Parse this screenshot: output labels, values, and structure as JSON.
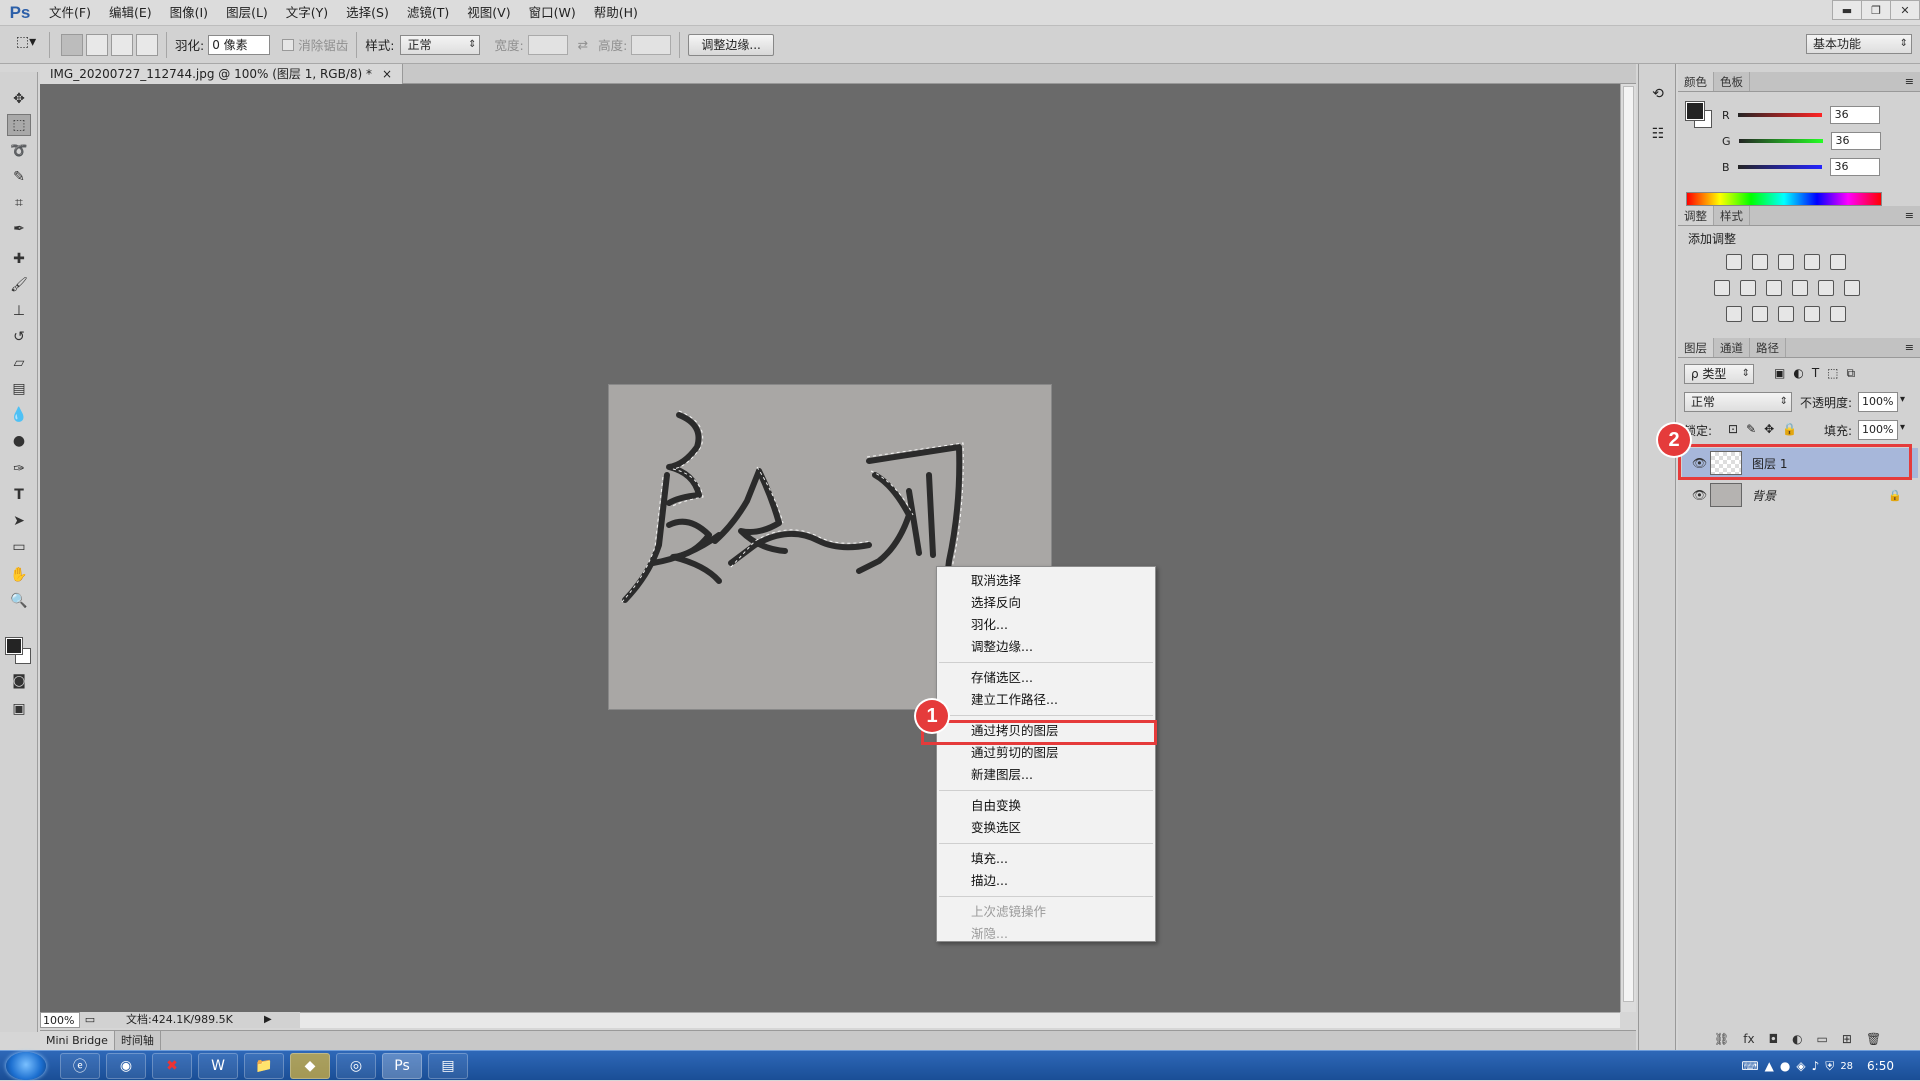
{
  "app": {
    "logo": "Ps"
  },
  "menubar": {
    "items": [
      "文件(F)",
      "编辑(E)",
      "图像(I)",
      "图层(L)",
      "文字(Y)",
      "选择(S)",
      "滤镜(T)",
      "视图(V)",
      "窗口(W)",
      "帮助(H)"
    ]
  },
  "window_controls": {
    "minimize": "▬",
    "restore": "❐",
    "close": "✕"
  },
  "options_bar": {
    "feather_label": "羽化:",
    "feather_value": "0 像素",
    "antialias_label": "消除锯齿",
    "style_label": "样式:",
    "style_value": "正常",
    "width_label": "宽度:",
    "height_label": "高度:",
    "refine_edge_button": "调整边缘...",
    "workspace": "基本功能"
  },
  "document": {
    "tab_title": "IMG_20200727_112744.jpg @ 100% (图层 1, RGB/8) *",
    "tab_close": "×",
    "zoom": "100%",
    "doc_info": "文档:424.1K/989.5K"
  },
  "bottom_tabs": [
    "Mini Bridge",
    "时间轴"
  ],
  "context_menu": {
    "items": [
      {
        "label": "取消选择",
        "enabled": true
      },
      {
        "label": "选择反向",
        "enabled": true
      },
      {
        "label": "羽化...",
        "enabled": true
      },
      {
        "label": "调整边缘...",
        "enabled": true
      },
      {
        "sep": true
      },
      {
        "label": "存储选区...",
        "enabled": true
      },
      {
        "label": "建立工作路径...",
        "enabled": true
      },
      {
        "sep": true
      },
      {
        "label": "通过拷贝的图层",
        "enabled": true,
        "highlighted": true
      },
      {
        "label": "通过剪切的图层",
        "enabled": true
      },
      {
        "label": "新建图层...",
        "enabled": true
      },
      {
        "sep": true
      },
      {
        "label": "自由变换",
        "enabled": true
      },
      {
        "label": "变换选区",
        "enabled": true
      },
      {
        "sep": true
      },
      {
        "label": "填充...",
        "enabled": true
      },
      {
        "label": "描边...",
        "enabled": true
      },
      {
        "sep": true
      },
      {
        "label": "上次滤镜操作",
        "enabled": false
      },
      {
        "label": "渐隐...",
        "enabled": false
      }
    ]
  },
  "annotations": {
    "step1": "1",
    "step2": "2",
    "highlight_color": "#e53b3b"
  },
  "color_panel": {
    "tabs": [
      "颜色",
      "色板"
    ],
    "r_label": "R",
    "g_label": "G",
    "b_label": "B",
    "r": "36",
    "g": "36",
    "b": "36"
  },
  "adjustments_panel": {
    "tabs": [
      "调整",
      "样式"
    ],
    "title": "添加调整"
  },
  "layers_panel": {
    "tabs": [
      "图层",
      "通道",
      "路径"
    ],
    "filter_kind": "ρ 类型",
    "blend_mode": "正常",
    "opacity_label": "不透明度:",
    "opacity": "100%",
    "lock_label": "锁定:",
    "fill_label": "填充:",
    "fill": "100%",
    "layers": [
      {
        "name": "图层 1",
        "selected": true,
        "visible": true,
        "locked": false
      },
      {
        "name": "背景",
        "selected": false,
        "visible": true,
        "locked": true
      }
    ]
  },
  "taskbar": {
    "apps": [
      "e-icon",
      "firefox-icon",
      "xmind-icon",
      "word-icon",
      "explorer-icon",
      "qq-browser-icon",
      "chrome-icon",
      "photoshop-icon",
      "notepad-icon"
    ],
    "tray_date": "28",
    "clock": "6:50"
  },
  "colors": {
    "accent": "#e53b3b",
    "layer_selected": "#a7b7da",
    "canvas_bg": "#6a6a6a"
  }
}
